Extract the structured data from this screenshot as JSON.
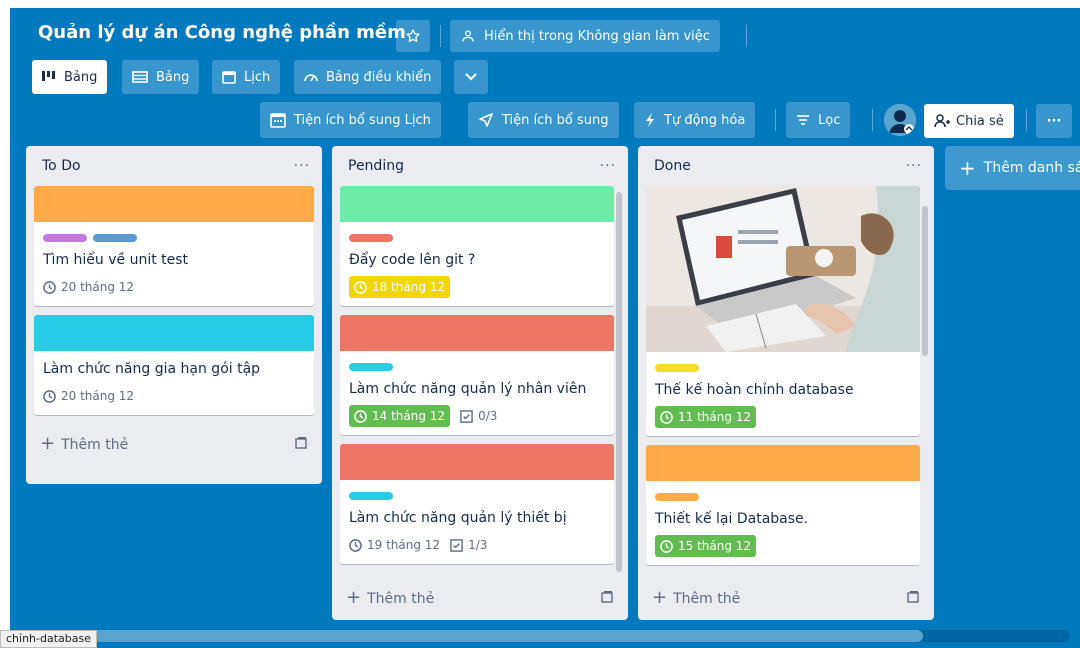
{
  "header": {
    "board_title": "Quản lý dự án Công nghệ phần mềm",
    "workspace_visibility": "Hiển thị trong Không gian làm việc",
    "views": [
      {
        "label": "Bảng",
        "active": true
      },
      {
        "label": "Bảng",
        "active": false
      },
      {
        "label": "Lịch",
        "active": false
      },
      {
        "label": "Bảng điều khiển",
        "active": false
      }
    ],
    "powerups_calendar": "Tiện ích bổ sung Lịch",
    "powerups": "Tiện ích bổ sung",
    "automation": "Tự động hóa",
    "filter": "Lọc",
    "share": "Chia sẻ",
    "more": "···"
  },
  "lists": [
    {
      "title": "To Do",
      "add_card": "Thêm thẻ",
      "cards": [
        {
          "cover": "#ffab4a",
          "labels": [
            "#c377e0",
            "#5a9ad5"
          ],
          "title": "Tìm hiểu về unit test",
          "due": "20 tháng 12",
          "due_style": "plain"
        },
        {
          "cover": "#29cce5",
          "labels": [],
          "title": "Làm chức năng gia hạn gói tập",
          "due": "20 tháng 12",
          "due_style": "plain"
        }
      ]
    },
    {
      "title": "Pending",
      "add_card": "Thêm thẻ",
      "cards": [
        {
          "cover": "#6deca9",
          "labels": [
            "#ef7564"
          ],
          "title": "Đẩy code lên git ?",
          "due": "18 tháng 12",
          "due_style": "yellow"
        },
        {
          "cover": "#ef7564",
          "labels": [
            "#29cce5"
          ],
          "title": "Làm chức năng quản lý nhân viên",
          "due": "14 tháng 12",
          "due_style": "green",
          "checklist": "0/3"
        },
        {
          "cover": "#ef7564",
          "labels": [
            "#29cce5"
          ],
          "title": "Làm chức năng quản lý thiết bị",
          "due": "19 tháng 12",
          "due_style": "plain",
          "checklist": "1/3"
        }
      ]
    },
    {
      "title": "Done",
      "add_card": "Thêm thẻ",
      "cards": [
        {
          "cover": "photo",
          "labels": [
            "#f5dd29"
          ],
          "title": "Thế kế hoàn chỉnh database",
          "due": "11 tháng 12",
          "due_style": "green"
        },
        {
          "cover": "#ffab4a",
          "labels": [
            "#ffab4a"
          ],
          "title": "Thiết kế lại Database.",
          "due": "15 tháng 12",
          "due_style": "green"
        }
      ]
    }
  ],
  "add_list": "Thêm danh sá",
  "status_tip": "chỉnh-database",
  "colors": {
    "board_bg": "#0079bf",
    "due_green": "#61bd4f",
    "due_yellow": "#f2d600"
  }
}
